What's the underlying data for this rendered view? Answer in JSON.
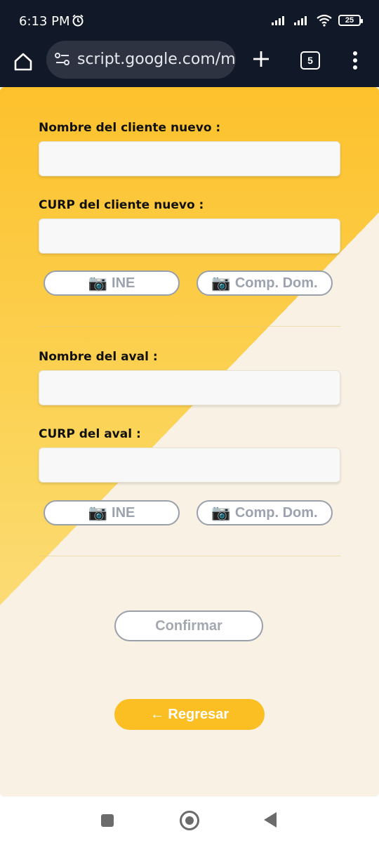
{
  "status_bar": {
    "time": "6:13 PM",
    "battery": "25"
  },
  "browser": {
    "url": "script.google.com/m",
    "tab_count": "5"
  },
  "form": {
    "client_name_label": "Nombre del cliente nuevo :",
    "client_name_value": "",
    "client_curp_label": "CURP del cliente nuevo :",
    "client_curp_value": "",
    "client_ine_button": "INE",
    "client_comp_button": "Comp. Dom.",
    "aval_name_label": "Nombre del aval :",
    "aval_name_value": "",
    "aval_curp_label": "CURP del aval :",
    "aval_curp_value": "",
    "aval_ine_button": "INE",
    "aval_comp_button": "Comp. Dom.",
    "camera_glyph": "📷",
    "confirm_button": "Confirmar",
    "back_button": "← Regresar"
  },
  "colors": {
    "primary_yellow": "#fbbf24",
    "pale_cream": "#f8f1e4",
    "chrome_dark": "#111827"
  }
}
